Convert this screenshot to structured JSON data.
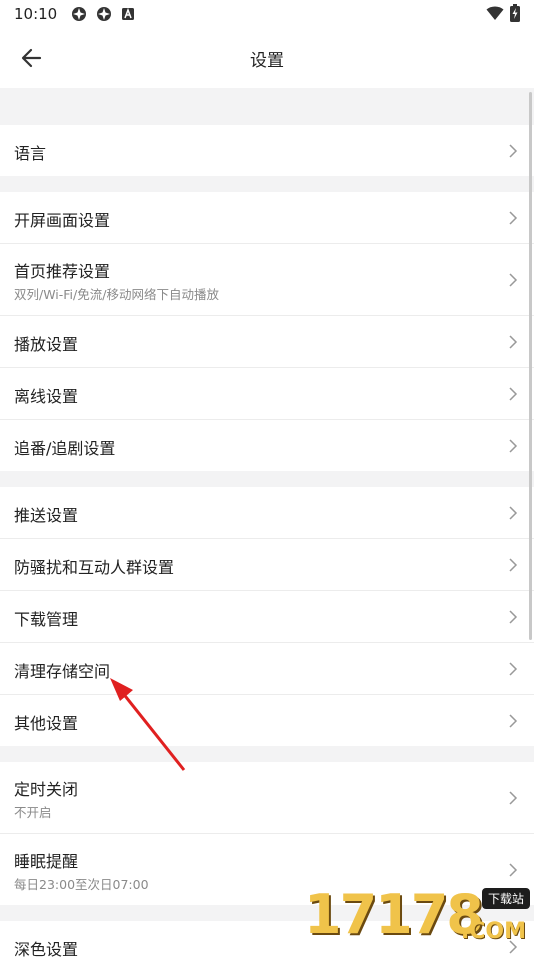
{
  "status_bar": {
    "time": "10:10",
    "icons": [
      "app-notification-icon",
      "app-notification-icon",
      "text-badge-icon"
    ],
    "right_icons": [
      "wifi-icon",
      "battery-charging-icon"
    ]
  },
  "header": {
    "title": "设置",
    "back_icon": "arrow-left-icon"
  },
  "groups": [
    {
      "rows": [
        {
          "label": "语言"
        }
      ]
    },
    {
      "rows": [
        {
          "label": "开屏画面设置"
        },
        {
          "label": "首页推荐设置",
          "subtitle": "双列/Wi-Fi/免流/移动网络下自动播放"
        },
        {
          "label": "播放设置"
        },
        {
          "label": "离线设置"
        },
        {
          "label": "追番/追剧设置"
        }
      ]
    },
    {
      "rows": [
        {
          "label": "推送设置"
        },
        {
          "label": "防骚扰和互动人群设置"
        },
        {
          "label": "下载管理"
        },
        {
          "label": "清理存储空间"
        },
        {
          "label": "其他设置"
        }
      ]
    },
    {
      "rows": [
        {
          "label": "定时关闭",
          "subtitle": "不开启"
        },
        {
          "label": "睡眠提醒",
          "subtitle": "每日23:00至次日07:00"
        }
      ]
    },
    {
      "rows": [
        {
          "label": "深色设置"
        }
      ]
    }
  ],
  "watermark": {
    "text": "17178",
    "badge": "下载站",
    "domain": ".COM"
  },
  "colors": {
    "annotation_arrow": "#e02020",
    "background": "#f3f3f4",
    "card": "#ffffff"
  }
}
